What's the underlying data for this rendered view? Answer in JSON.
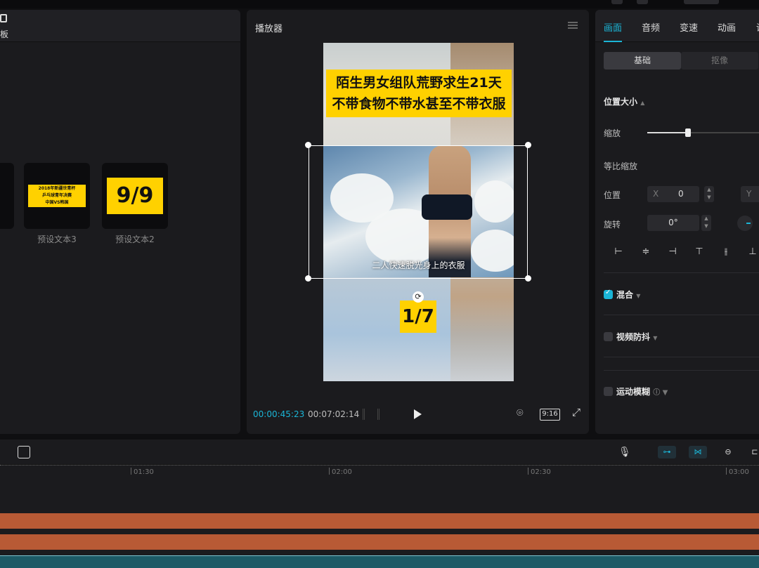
{
  "left_panel": {
    "title": "板",
    "presets": [
      {
        "label": "预设文本3",
        "thumb_lines": [
          "2018年新疆世青杯",
          "乒乓球青年决赛",
          "中国VS韩国"
        ]
      },
      {
        "label": "预设文本2",
        "thumb_text": "9/9"
      }
    ]
  },
  "player": {
    "title": "播放器",
    "banner_line1": "陌生男女组队荒野求生21天",
    "banner_line2": "不带食物不带水甚至不带衣服",
    "subtitle": "二人快速脱光身上的衣服",
    "page_badge": "1/7",
    "time_current": "00:00:45:23",
    "time_total": "00:07:02:14",
    "ratio": "9:16"
  },
  "inspector": {
    "tabs": [
      "画面",
      "音频",
      "变速",
      "动画",
      "调"
    ],
    "segments": [
      "基础",
      "抠像"
    ],
    "section_position": "位置大小",
    "scale_label": "缩放",
    "scale_value": 0.34,
    "uniform_label": "等比缩放",
    "position_label": "位置",
    "pos_x_label": "X",
    "pos_x": "0",
    "pos_y_label": "Y",
    "rotation_label": "旋转",
    "rotation": "0°",
    "blend_label": "混合",
    "blend_checked": true,
    "stabilize_label": "视频防抖",
    "motion_blur_label": "运动模糊"
  },
  "timeline": {
    "ticks": [
      "01:30",
      "02:00",
      "02:30",
      "03:00"
    ]
  },
  "colors": {
    "accent": "#1bb5d6",
    "caption_yellow": "#ffd100",
    "track_orange": "#b85a35",
    "track_teal": "#1d5a66"
  }
}
